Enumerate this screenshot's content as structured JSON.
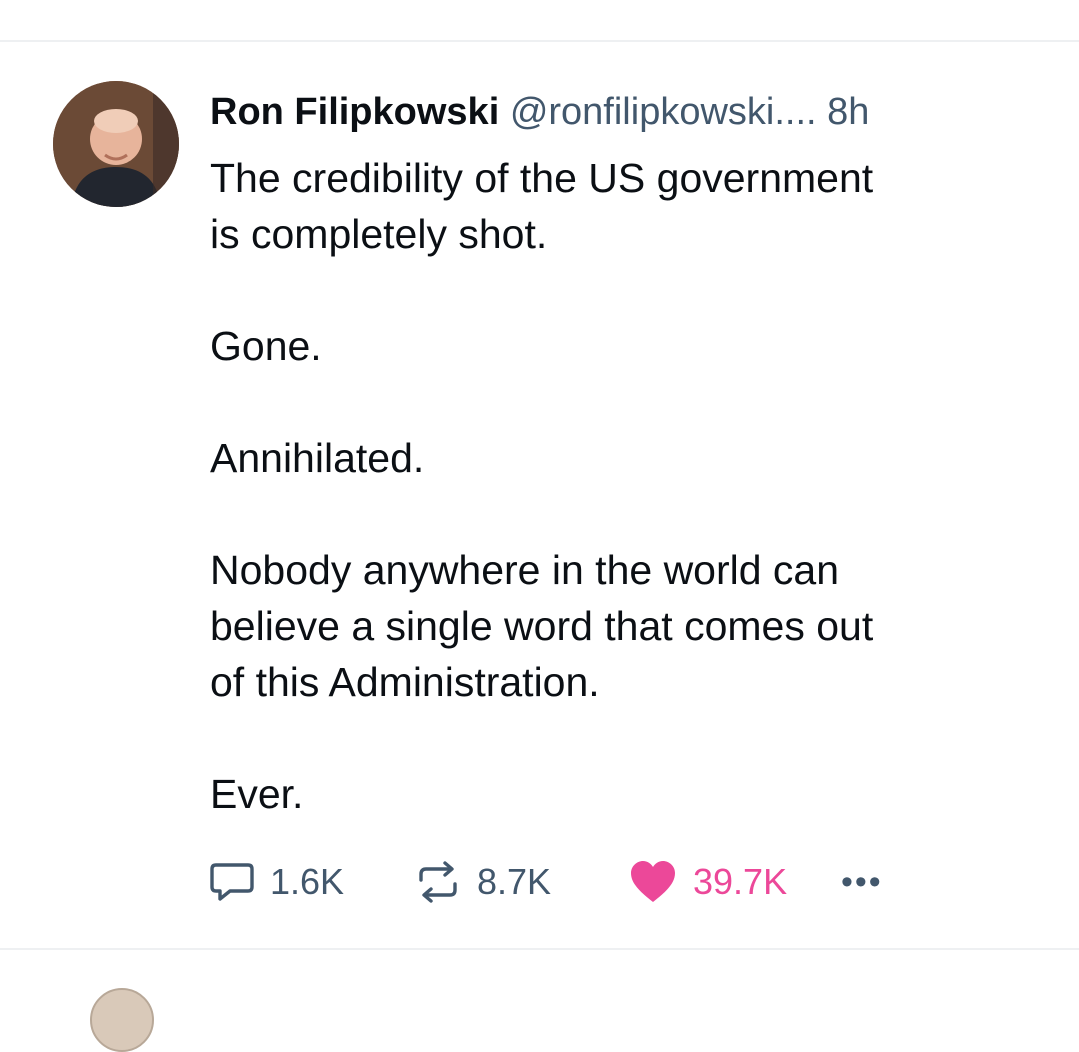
{
  "post": {
    "author_name": "Ron Filipkowski",
    "handle": "@ronfilipkowski....",
    "timestamp": "8h",
    "text": "The credibility of the US government\nis completely shot.\n\nGone.\n\nAnnihilated.\n\nNobody anywhere in the world can\nbelieve a single word that comes out\nof this Administration.\n\nEver.",
    "actions": {
      "reply_count": "1.6K",
      "repost_count": "8.7K",
      "like_count": "39.7K",
      "more_label": "•••"
    },
    "icons": {
      "reply": "speech-bubble-icon",
      "repost": "repost-arrows-icon",
      "like": "heart-icon",
      "more": "more-dots-icon"
    }
  },
  "colors": {
    "text": "#0b0f14",
    "secondary": "#42576c",
    "like_accent": "#ec4899",
    "divider": "#eef0f2"
  }
}
